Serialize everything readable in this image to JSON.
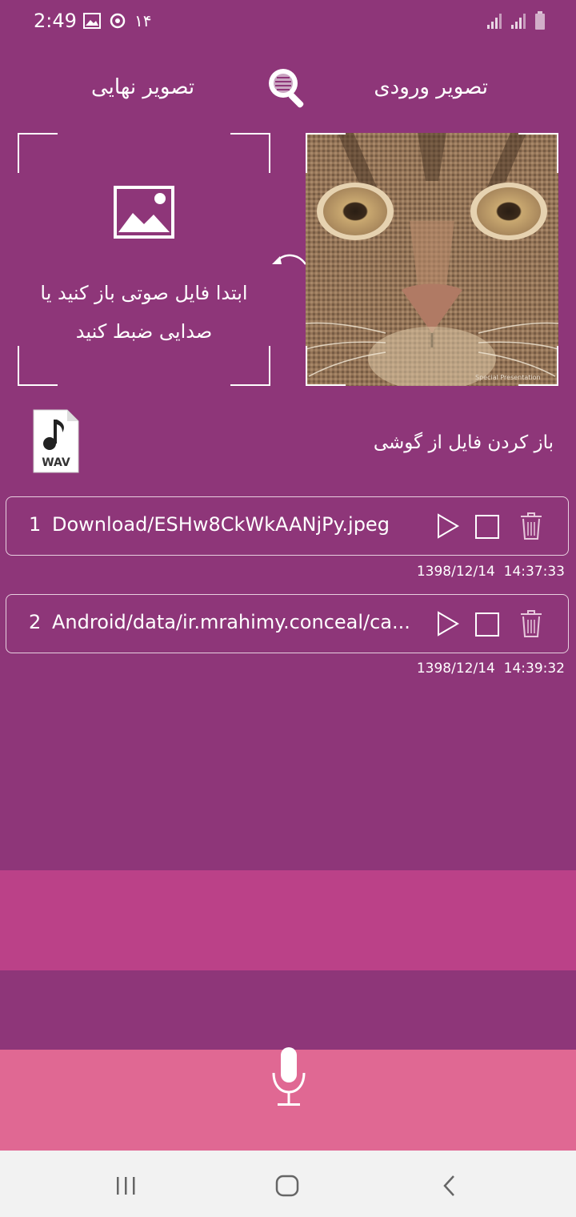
{
  "status": {
    "time": "2:49",
    "extra_text": "۱۴",
    "icons": [
      "image-icon",
      "sync-icon",
      "signal-icon",
      "signal-icon",
      "battery-icon"
    ]
  },
  "tabs": {
    "final_image": "تصویر نهایی",
    "input_image": "تصویر ورودی"
  },
  "preview": {
    "message": "ابتدا فایل صوتی باز کنید یا صدایی ضبط کنید",
    "photo_watermark": "Special Presentation"
  },
  "open_file": {
    "label": "باز کردن فایل از گوشی",
    "wav_text": "WAV"
  },
  "files": [
    {
      "index": "1",
      "path": "Download/ESHw8CkWkAANjPy.jpeg",
      "date": "1398/12/14",
      "time": "14:37:33"
    },
    {
      "index": "2",
      "path": "Android/data/ir.mrahimy.conceal/ca...",
      "date": "1398/12/14",
      "time": "14:39:32"
    }
  ],
  "colors": {
    "background": "#8e3679",
    "band": "#bb4188",
    "mic_band": "#e06893",
    "navbar": "#f2f2f2"
  }
}
